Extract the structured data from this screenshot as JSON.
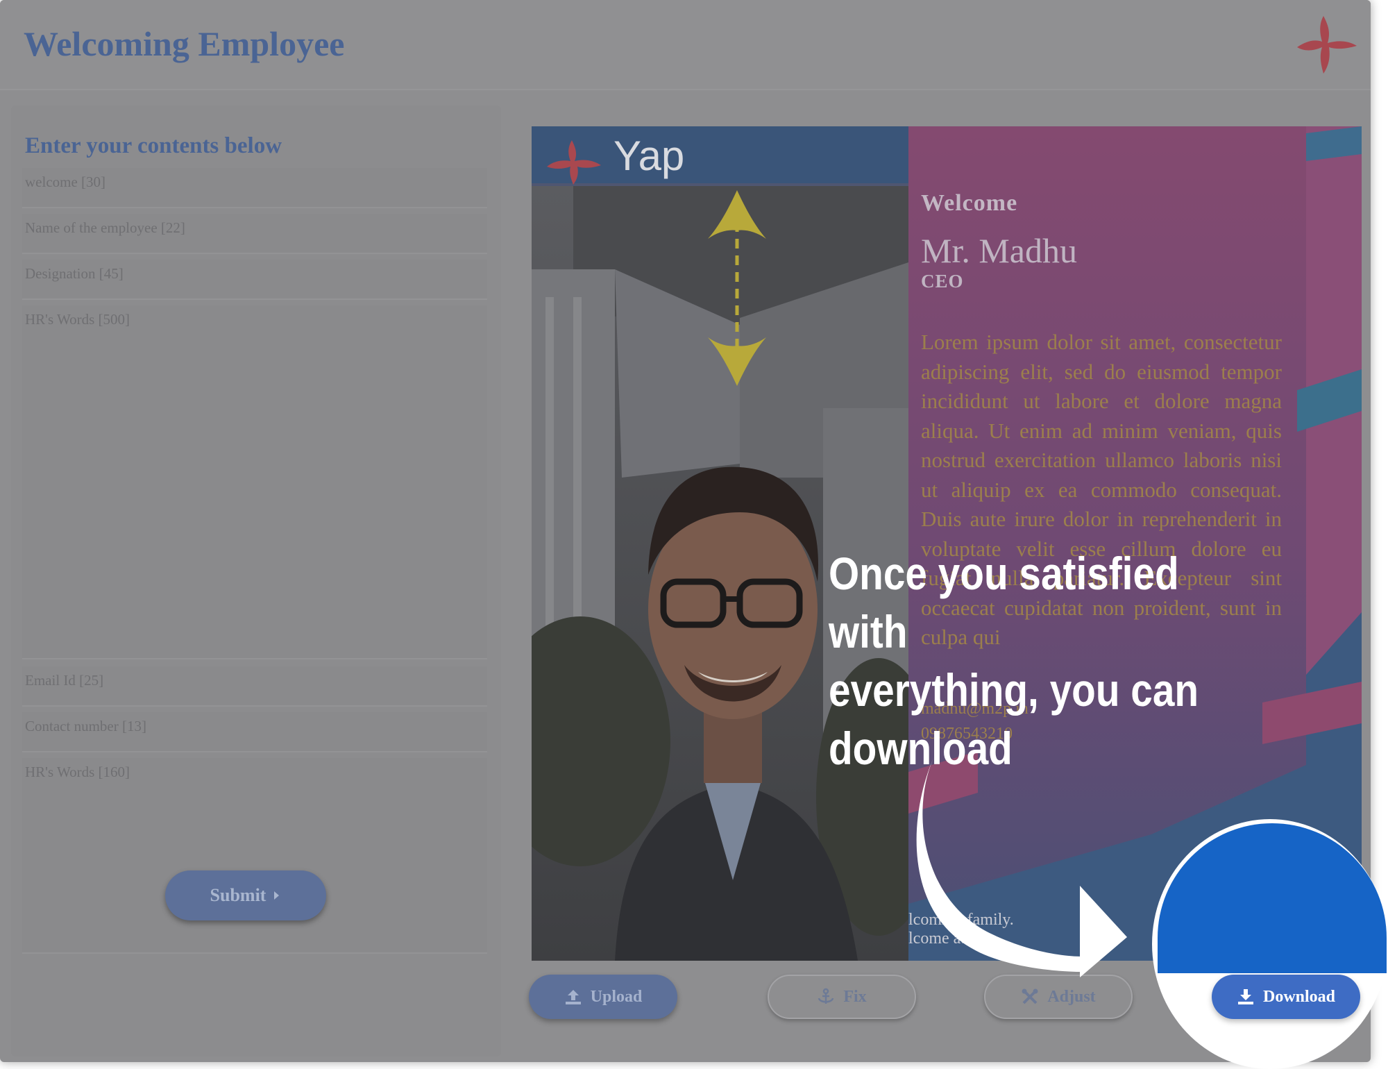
{
  "header": {
    "title": "Welcoming Employee"
  },
  "form": {
    "title": "Enter your contents below",
    "fields": [
      {
        "placeholder": "welcome [30]"
      },
      {
        "placeholder": "Name of the employee [22]"
      },
      {
        "placeholder": "Designation [45]"
      },
      {
        "placeholder": "HR's Words [500]"
      },
      {
        "placeholder": "Email Id [25]"
      },
      {
        "placeholder": "Contact number [13]"
      },
      {
        "placeholder": "HR's Words [160]"
      }
    ],
    "submit_label": "Submit"
  },
  "card": {
    "brand": "Yap",
    "welcome": "Welcome",
    "name": "Mr. Madhu",
    "designation": "CEO",
    "body": "Lorem ipsum dolor sit amet, consectetur adipiscing elit, sed do eiusmod tempor incididunt ut labore et dolore magna aliqua. Ut enim ad minim veniam, quis nostrud exercitation ullamco laboris nisi ut aliquip ex ea commodo consequat. Duis aute irure dolor in reprehenderit in voluptate velit esse cillum dolore eu fugiat nulla pariatur. Excepteur sint occaecat cupidatat non proident, sunt in culpa qui",
    "email": "madhu@m2p.in",
    "phone": "09876543210",
    "footer_line1": "lcoming family.",
    "footer_line2": "lcome abo"
  },
  "toolbar": {
    "upload_label": "Upload",
    "fix_label": "Fix",
    "adjust_label": "Adjust",
    "download_label": "Download"
  },
  "hint": {
    "line1": "Once you satisfied with",
    "line2": "everything, you can",
    "line3": "download"
  },
  "colors": {
    "accent": "#3e6cc4",
    "title": "#4a6494",
    "card_pink": "#7a4a6c",
    "spotlight_blue": "#1664c6",
    "arrow_yellow": "#b8a93a"
  }
}
